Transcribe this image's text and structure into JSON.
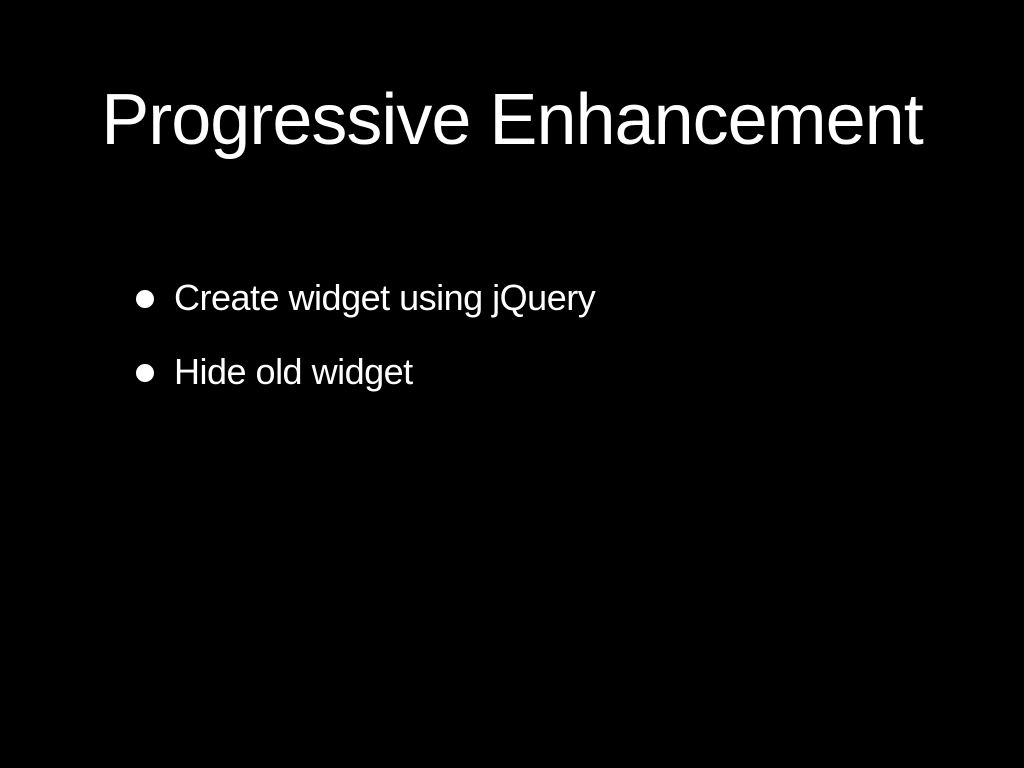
{
  "slide": {
    "title": "Progressive Enhancement",
    "bullets": [
      "Create widget using jQuery",
      "Hide old widget"
    ],
    "colors": {
      "background": "#000000",
      "text": "#ffffff"
    },
    "icons": [
      "bullet-dot-icon"
    ]
  }
}
